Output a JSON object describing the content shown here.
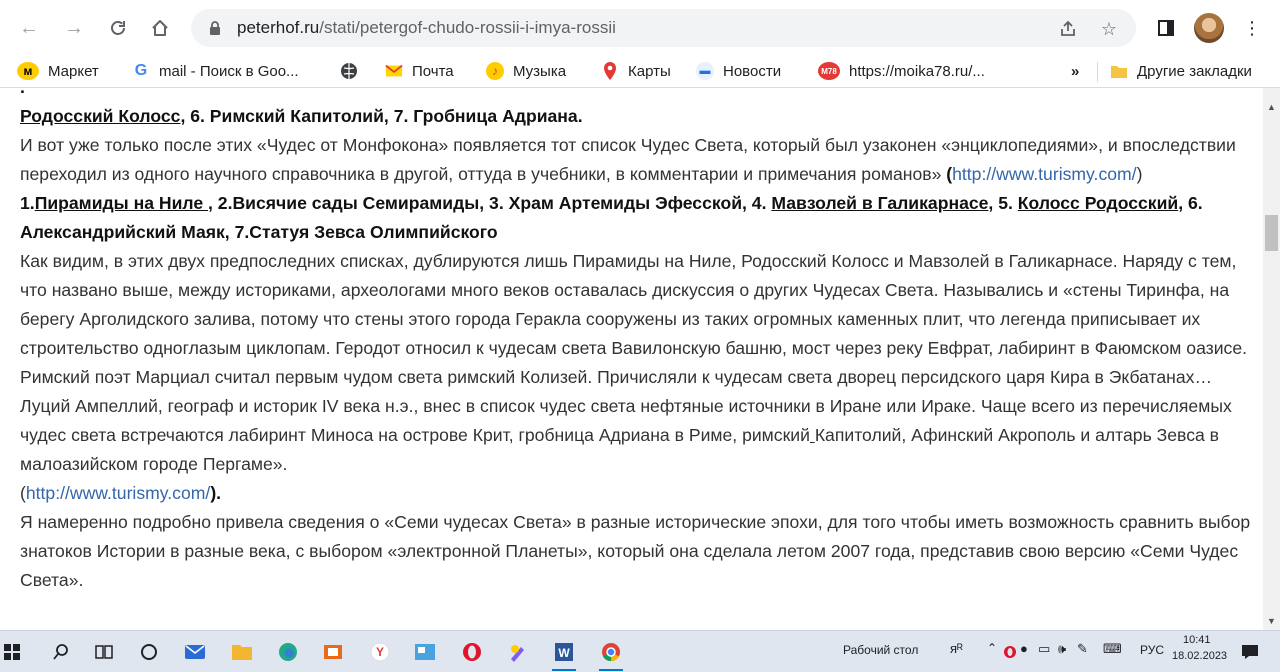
{
  "browser": {
    "url_host": "peterhof.ru",
    "url_path": "/stati/petergof-chudo-rossii-i-imya-rossii"
  },
  "bookmarks": {
    "items": [
      {
        "label": "Маркет",
        "icon": "yandex-market-icon"
      },
      {
        "label": "mail - Поиск в Goo...",
        "icon": "google-icon"
      },
      {
        "label": "",
        "icon": "globe-icon"
      },
      {
        "label": "Почта",
        "icon": "mail-icon"
      },
      {
        "label": "Музыка",
        "icon": "music-icon"
      },
      {
        "label": "Карты",
        "icon": "maps-pin-icon"
      },
      {
        "label": "Новости",
        "icon": "news-icon"
      },
      {
        "label": "https://moika78.ru/...",
        "icon": "m78-icon"
      }
    ],
    "more": "»",
    "other": "Другие закладки"
  },
  "article": {
    "p1_b1": "Родосский Колосс",
    "p1_rest": ", 6. Римский Капитолий, 7. Гробница Адриана.",
    "p2": "И вот уже только после этих «Чудес от Монфокона» появляется тот список Чудес Света, который был узаконен «энциклопедиями», и впоследствии переходил из одного научного справочника в другой, оттуда в учебники, в комментарии и примечания романов»",
    "p2_open": "(",
    "link1": "http://www.turismy.com/",
    "p2_close": ")",
    "l_1": "1.",
    "l_pyramids": "Пирамиды на Ниле ",
    "l_mid1": ", 2.Висячие сады Семирамиды, 3. Храм Артемиды Эфесской, 4. ",
    "l_mausoleum": "Мавзолей в Галикарнасе",
    "l_mid2": ", 5. ",
    "l_colossus": "Колосс Родосский",
    "l_end": ", 6. Александрийский Маяк, 7.Статуя Зевса Олимпийского",
    "p4a": "Как видим, в этих двух предпоследних списках, дублируются лишь Пирамиды на Ниле, Родосский Колосс и Мавзолей в Галикарнасе. Наряду с тем, что названо выше, между историками, археологами много веков оставалась дискуссия о других Чудесах Света. Назывались и «стены Тиринфа, на берегу Арголидского залива, потому что стены этого города Геракла сооружены из таких огромных каменных плит, что легенда приписывает их строительство одноглазым циклопам. Геродот относил к чудесам света Вавилонскую башню, мост через реку Евфрат, лабиринт в Фаюмском оазисе. Римский поэт Марциал считал первым чудом света римский Колизей. Причисляли к чудесам света дворец персидского царя Кира в Экбатанах… Луций Ампеллий, географ и историк IV века н.э., внес в список чудес света нефтяные источники в Иране или Ираке. Чаще всего из перечисляемых чудес света встречаются лабиринт Миноса на острове Крит, гробница Адриана в Риме, римский",
    "p4b": "Капитолий, Афинский Акрополь и алтарь Зевса в малоазийском городе Пергаме».",
    "p4_open": "(",
    "link2": "http://www.turismy.com/",
    "p4_close": ").",
    "p5": "Я намеренно подробно привела сведения о «Семи чудесах Света» в разные исторические эпохи, для того чтобы иметь возможность сравнить выбор знатоков Истории в разные века, с выбором «электронной Планеты», который она сделала летом 2007 года, представив свою версию «Семи Чудес Света»."
  },
  "taskbar": {
    "desktop_label": "Рабочий стол",
    "lang": "РУС",
    "time": "10:41",
    "date": "18.02.2023"
  }
}
